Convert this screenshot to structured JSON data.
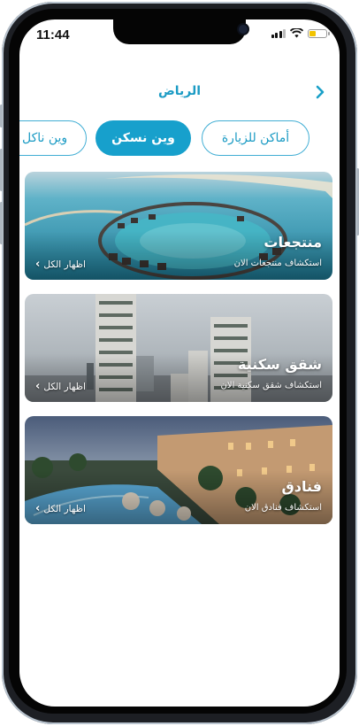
{
  "status_bar": {
    "time": "11:44"
  },
  "header": {
    "title": "الرياض",
    "back_icon": "chevron-right-icon"
  },
  "tabs": [
    {
      "label": "أماكن للزيارة",
      "active": false
    },
    {
      "label": "وين نسكن",
      "active": true
    },
    {
      "label": "وين ناكل",
      "active": false
    }
  ],
  "cards": [
    {
      "title": "منتجعات",
      "subtitle": "استكشاف منتجعات الان",
      "link": "اظهار الكل",
      "icon": "chevron-left-icon"
    },
    {
      "title": "شقق سكنية",
      "subtitle": "استكشاف شقق سكنية الان",
      "link": "اظهار الكل",
      "icon": "chevron-left-icon"
    },
    {
      "title": "فنادق",
      "subtitle": "استكشاف فنادق الان",
      "link": "اظهار الكل",
      "icon": "chevron-left-icon"
    }
  ],
  "colors": {
    "accent": "#17a0cc",
    "title": "#1b9bc4",
    "background": "#ffffff"
  }
}
